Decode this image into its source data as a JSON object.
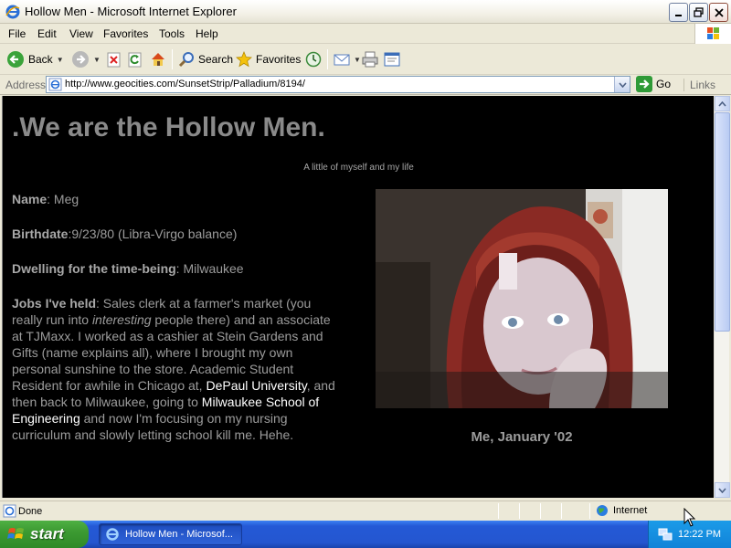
{
  "window": {
    "title": "Hollow Men - Microsoft Internet Explorer"
  },
  "menu": [
    "File",
    "Edit",
    "View",
    "Favorites",
    "Tools",
    "Help"
  ],
  "toolbar": {
    "back_label": "Back",
    "search_label": "Search",
    "favorites_label": "Favorites"
  },
  "address": {
    "label": "Address",
    "url": "http://www.geocities.com/SunsetStrip/Palladium/8194/",
    "go_label": "Go",
    "links_label": "Links"
  },
  "page": {
    "heading": ".We are the Hollow Men.",
    "subtitle": "A little of myself and my life",
    "bio": {
      "name_label": "Name",
      "name_value": ": Meg",
      "birthdate_label": "Birthdate",
      "birthdate_value": ":9/23/80 (Libra-Virgo balance)",
      "dwelling_label": "Dwelling for the time-being",
      "dwelling_value": ": Milwaukee",
      "jobs_label": "Jobs I've held",
      "jobs_text_1": ": Sales clerk at a farmer's market (you really run into ",
      "jobs_text_em": "interesting",
      "jobs_text_2": " people there) and an associate at TJMaxx. I worked as a cashier at Stein Gardens and Gifts (name explains all), where I brought my own personal sunshine to the store. Academic Student Resident for awhile in Chicago at, ",
      "link_depaul": "DePaul University",
      "jobs_text_3": ", and then back to Milwaukee, going to ",
      "link_msoe": "Milwaukee School of Engineering",
      "jobs_text_4": " and now I'm focusing on my nursing curriculum and slowly letting school kill me. Hehe."
    },
    "photo_caption": "Me, January '02"
  },
  "status": {
    "text": "Done",
    "zone": "Internet"
  },
  "taskbar": {
    "start_label": "start",
    "task_label": "Hollow Men - Microsof...",
    "clock": "12:22 PM"
  },
  "colors": {
    "page_bg": "#000000",
    "text_gray": "#9c9c9c",
    "link": "#ffffff",
    "taskbar_blue": "#2456d0",
    "start_green": "#3c9a32"
  }
}
